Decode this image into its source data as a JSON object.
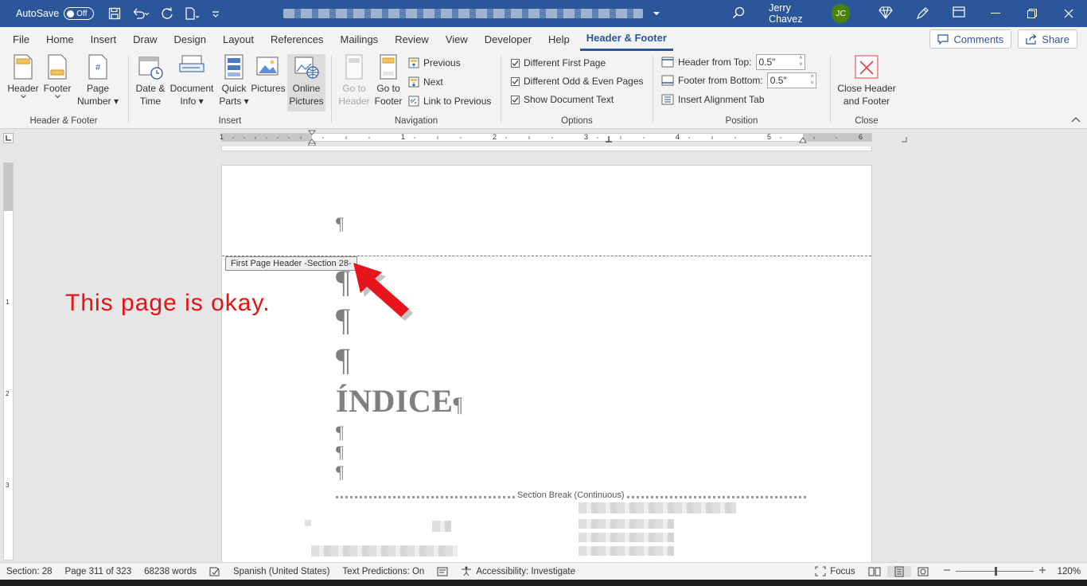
{
  "titlebar": {
    "autosave_label": "AutoSave",
    "autosave_state": "Off",
    "user_name": "Jerry Chavez",
    "user_initials": "JC",
    "accent": "#2b579a",
    "avatar_color": "#498205"
  },
  "tabs": [
    {
      "label": "File"
    },
    {
      "label": "Home"
    },
    {
      "label": "Insert"
    },
    {
      "label": "Draw"
    },
    {
      "label": "Design"
    },
    {
      "label": "Layout"
    },
    {
      "label": "References"
    },
    {
      "label": "Mailings"
    },
    {
      "label": "Review"
    },
    {
      "label": "View"
    },
    {
      "label": "Developer"
    },
    {
      "label": "Help"
    },
    {
      "label": "Header & Footer"
    }
  ],
  "actions": {
    "comments": "Comments",
    "share": "Share"
  },
  "ribbon": {
    "hf_group": {
      "label": "Header & Footer",
      "header": "Header",
      "footer": "Footer",
      "page_number_1": "Page",
      "page_number_2": "Number"
    },
    "insert_group": {
      "label": "Insert",
      "date_1": "Date &",
      "date_2": "Time",
      "docinfo_1": "Document",
      "docinfo_2": "Info",
      "quick_1": "Quick",
      "quick_2": "Parts",
      "pictures": "Pictures",
      "online_1": "Online",
      "online_2": "Pictures"
    },
    "nav_group": {
      "label": "Navigation",
      "goto_header_1": "Go to",
      "goto_header_2": "Header",
      "goto_footer_1": "Go to",
      "goto_footer_2": "Footer",
      "previous": "Previous",
      "next": "Next",
      "link_previous": "Link to Previous"
    },
    "options_group": {
      "label": "Options",
      "diff_first": "Different First Page",
      "diff_odd_even": "Different Odd & Even Pages",
      "show_doc_text": "Show Document Text"
    },
    "position_group": {
      "label": "Position",
      "header_from_top": "Header from Top:",
      "header_from_top_value": "0.5\"",
      "footer_from_bottom": "Footer from Bottom:",
      "footer_from_bottom_value": "0.5\"",
      "insert_alignment_tab": "Insert Alignment Tab"
    },
    "close_group": {
      "label": "Close",
      "close_1": "Close Header",
      "close_2": "and Footer"
    }
  },
  "ruler": {
    "numbers": [
      "1",
      "1",
      "2",
      "3",
      "4",
      "5",
      "6"
    ],
    "vnumbers": [
      "1",
      "2",
      "3"
    ]
  },
  "document": {
    "pilcrow": "¶",
    "header_tag": "First Page Header -Section 28-",
    "heading": "ÍNDICE",
    "section_break": "Section Break (Continuous)",
    "annotation": "This page is okay.",
    "annotation_color": "#e81010"
  },
  "status": {
    "section": "Section: 28",
    "page": "Page 311 of 323",
    "words": "68238 words",
    "language": "Spanish (United States)",
    "text_predictions": "Text Predictions: On",
    "accessibility": "Accessibility: Investigate",
    "focus": "Focus",
    "zoom": "120%"
  }
}
